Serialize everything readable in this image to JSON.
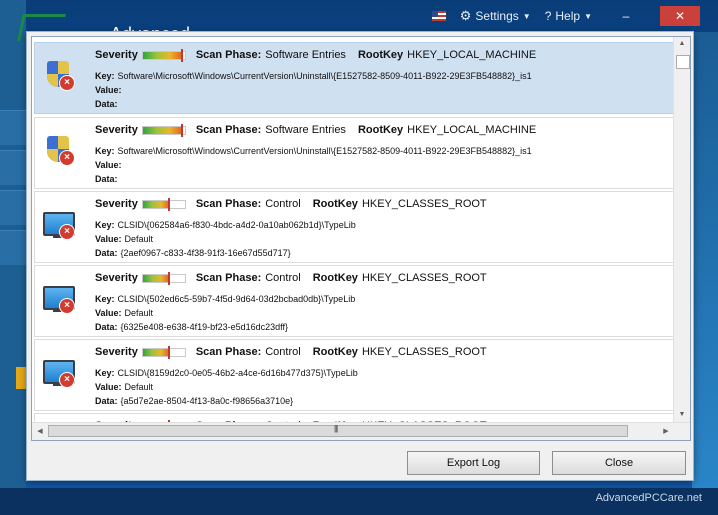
{
  "topbar": {
    "settings_label": "Settings",
    "help_label": "Help",
    "minimize_label": "–",
    "close_label": "✕"
  },
  "background_app": {
    "title_fragment": "Advanced",
    "watermark": "AdvancedPCCare.net"
  },
  "entries": [
    {
      "icon": "shield-icon",
      "selected": true,
      "severity": 0.95,
      "severity_label": "Severity",
      "scan_phase_label": "Scan Phase:",
      "scan_phase": "Software Entries",
      "root_key_label": "RootKey",
      "root_key": "HKEY_LOCAL_MACHINE",
      "key_label": "Key:",
      "key": "Software\\Microsoft\\Windows\\CurrentVersion\\Uninstall\\{E1527582-8509-4011-B922-29E3FB548882}_is1",
      "value_label": "Value:",
      "value": "",
      "data_label": "Data:",
      "data": ""
    },
    {
      "icon": "shield-icon",
      "selected": false,
      "severity": 0.95,
      "severity_label": "Severity",
      "scan_phase_label": "Scan Phase:",
      "scan_phase": "Software Entries",
      "root_key_label": "RootKey",
      "root_key": "HKEY_LOCAL_MACHINE",
      "key_label": "Key:",
      "key": "Software\\Microsoft\\Windows\\CurrentVersion\\Uninstall\\{E1527582-8509-4011-B922-29E3FB548882}_is1",
      "value_label": "Value:",
      "value": "",
      "data_label": "Data:",
      "data": ""
    },
    {
      "icon": "monitor-icon",
      "selected": false,
      "severity": 0.65,
      "severity_label": "Severity",
      "scan_phase_label": "Scan Phase:",
      "scan_phase": "Control",
      "root_key_label": "RootKey",
      "root_key": "HKEY_CLASSES_ROOT",
      "key_label": "Key:",
      "key": "CLSID\\{062584a6-f830-4bdc-a4d2-0a10ab062b1d}\\TypeLib",
      "value_label": "Value:",
      "value": "Default",
      "data_label": "Data:",
      "data": "{2aef0967-c833-4f38-91f3-16e67d55d717}"
    },
    {
      "icon": "monitor-icon",
      "selected": false,
      "severity": 0.65,
      "severity_label": "Severity",
      "scan_phase_label": "Scan Phase:",
      "scan_phase": "Control",
      "root_key_label": "RootKey",
      "root_key": "HKEY_CLASSES_ROOT",
      "key_label": "Key:",
      "key": "CLSID\\{502ed6c5-59b7-4f5d-9d64-03d2bcbad0db}\\TypeLib",
      "value_label": "Value:",
      "value": "Default",
      "data_label": "Data:",
      "data": "{6325e408-e638-4f19-bf23-e5d16dc23dff}"
    },
    {
      "icon": "monitor-icon",
      "selected": false,
      "severity": 0.65,
      "severity_label": "Severity",
      "scan_phase_label": "Scan Phase:",
      "scan_phase": "Control",
      "root_key_label": "RootKey",
      "root_key": "HKEY_CLASSES_ROOT",
      "key_label": "Key:",
      "key": "CLSID\\{8159d2c0-0e05-46b2-a4ce-6d16b477d375}\\TypeLib",
      "value_label": "Value:",
      "value": "Default",
      "data_label": "Data:",
      "data": "{a5d7e2ae-8504-4f13-8a0c-f98656a3710e}"
    },
    {
      "icon": "monitor-icon",
      "selected": false,
      "severity": 0.65,
      "severity_label": "Severity",
      "scan_phase_label": "Scan Phase:",
      "scan_phase": "Control",
      "root_key_label": "RootKey",
      "root_key": "HKEY_CLASSES_ROOT",
      "key_label": "",
      "key": "",
      "value_label": "",
      "value": "",
      "data_label": "",
      "data": ""
    }
  ],
  "buttons": {
    "export_log": "Export Log",
    "close": "Close"
  },
  "colors": {
    "selected_row": "#cfe0f1",
    "close_button": "#c9413a",
    "severity_marker": "#c0392b"
  }
}
